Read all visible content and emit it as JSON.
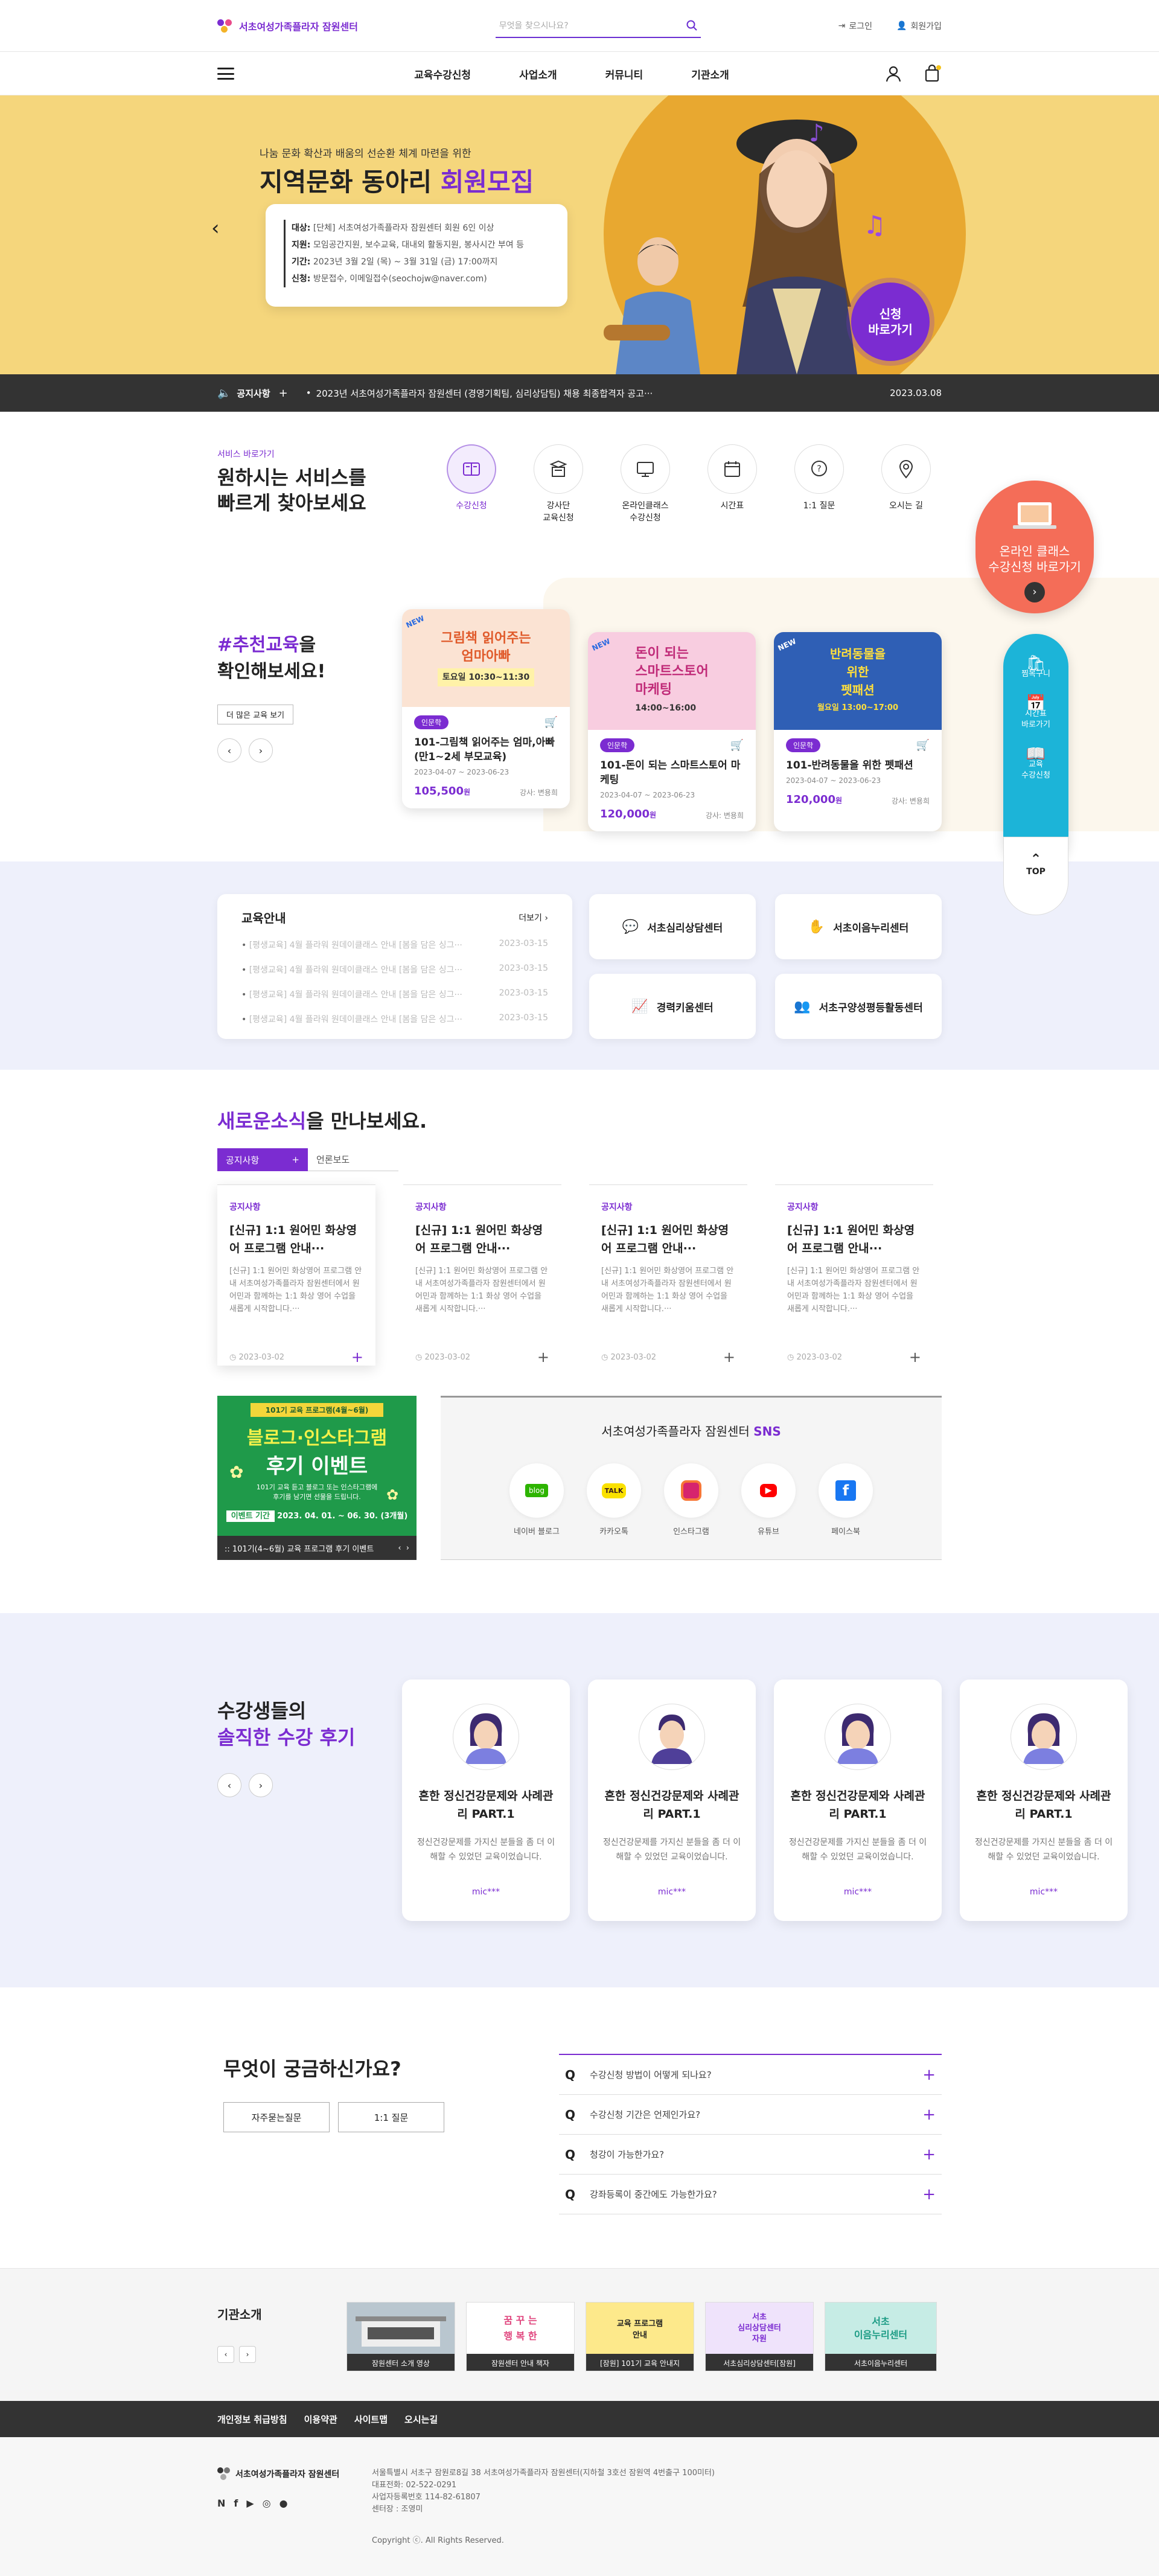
{
  "header": {
    "site_name": "서초여성가족플라자 잠원센터",
    "search_placeholder": "무엇을 찾으시나요?",
    "login": "로그인",
    "signup": "회원가입"
  },
  "gnb": {
    "items": [
      "교육수강신청",
      "사업소개",
      "커뮤니티",
      "기관소개"
    ]
  },
  "hero": {
    "subtitle": "나눔 문화 확산과 배움의 선순환 체계 마련을 위한",
    "title_prefix": "지역문화 동아리 ",
    "title_highlight": "회원모집",
    "rows": [
      {
        "label": "대상:",
        "text": "[단체] 서초여성가족플라자 잠원센터 회원 6인 이상"
      },
      {
        "label": "지원:",
        "text": "모임공간지원, 보수교육, 대내외 활동지원, 봉사시간 부여 등"
      },
      {
        "label": "기간:",
        "text": "2023년 3월 2일 (목) ~ 3월 31일 (금) 17:00까지"
      },
      {
        "label": "신청:",
        "text": "방문접수, 이메일접수(seochojw@naver.com)"
      }
    ],
    "cta": "신청\n바로가기"
  },
  "notice_bar": {
    "label": "공지사항",
    "text": "2023년 서초여성가족플라자 잠원센터 (경영기획팀, 심리상담팀) 채용 최종합격자 공고···",
    "date": "2023.03.08"
  },
  "quick": {
    "label": "서비스 바로가기",
    "title_line1": "원하시는 서비스를",
    "title_line2": "빠르게 찾아보세요",
    "items": [
      "수강신청",
      "강사단\n교육신청",
      "온라인클래스\n수강신청",
      "시간표",
      "1:1 질문",
      "오시는 길"
    ]
  },
  "recommend": {
    "title_highlight": "#추천교육",
    "title_rest1": "을",
    "title_line2": "확인해보세요!",
    "more": "더 많은 교육 보기",
    "cards": [
      {
        "thumb": "그림책 읽어주는\n엄마아빠",
        "thumb_sub": "토요일 10:30~11:30",
        "badge": "인문학",
        "title": "101-그림책 읽어주는 엄마,아빠(만1~2세 부모교육)",
        "date": "2023-04-07 ~ 2023-06-23",
        "price": "105,500",
        "won": "원",
        "teacher": "강사: 변용희"
      },
      {
        "thumb": "돈이 되는\n스마트스토어\n마케팅",
        "thumb_sub": "14:00~16:00",
        "badge": "인문학",
        "title": "101-돈이 되는 스마트스토어 마케팅",
        "date": "2023-04-07 ~ 2023-06-23",
        "price": "120,000",
        "won": "원",
        "teacher": "강사: 변용희"
      },
      {
        "thumb": "반려동물을\n위한\n펫패션",
        "thumb_sub": "월요일 13:00~17:00",
        "badge": "인문학",
        "title": "101-반려동물을 위한 펫패션",
        "date": "2023-04-07 ~ 2023-06-23",
        "price": "120,000",
        "won": "원",
        "teacher": "강사: 변용희"
      }
    ]
  },
  "edu_info": {
    "title": "교육안내",
    "more": "더보기",
    "items": [
      {
        "text": "[평생교육] 4월 플라워 원데이클래스 안내 [봄을 담은 싱그···",
        "date": "2023-03-15"
      },
      {
        "text": "[평생교육] 4월 플라워 원데이클래스 안내 [봄을 담은 싱그···",
        "date": "2023-03-15"
      },
      {
        "text": "[평생교육] 4월 플라워 원데이클래스 안내 [봄을 담은 싱그···",
        "date": "2023-03-15"
      },
      {
        "text": "[평생교육] 4월 플라워 원데이클래스 안내 [봄을 담은 싱그···",
        "date": "2023-03-15"
      }
    ],
    "centers": [
      "서초심리상담센터",
      "서초이음누리센터",
      "경력키움센터",
      "서초구양성평등활동센터"
    ]
  },
  "news": {
    "title_highlight": "새로운소식",
    "title_rest": "을 만나보세요.",
    "tab_active": "공지사항",
    "tab_other": "언론보도",
    "cards": [
      {
        "label": "공지사항",
        "title": "[신규] 1:1 원어민 화상영어 프로그램 안내···",
        "text": "[신규] 1:1 원어민 화상영어 프로그램 안내 서초여성가족플라자 잠원센터에서 원어민과 함께하는 1:1 화상 영어 수업을 새롭게 시작합니다.···",
        "date": "2023-03-02"
      },
      {
        "label": "공지사항",
        "title": "[신규] 1:1 원어민 화상영어 프로그램 안내···",
        "text": "[신규] 1:1 원어민 화상영어 프로그램 안내 서초여성가족플라자 잠원센터에서 원어민과 함께하는 1:1 화상 영어 수업을 새롭게 시작합니다.···",
        "date": "2023-03-02"
      },
      {
        "label": "공지사항",
        "title": "[신규] 1:1 원어민 화상영어 프로그램 안내···",
        "text": "[신규] 1:1 원어민 화상영어 프로그램 안내 서초여성가족플라자 잠원센터에서 원어민과 함께하는 1:1 화상 영어 수업을 새롭게 시작합니다.···",
        "date": "2023-03-02"
      },
      {
        "label": "공지사항",
        "title": "[신규] 1:1 원어민 화상영어 프로그램 안내···",
        "text": "[신규] 1:1 원어민 화상영어 프로그램 안내 서초여성가족플라자 잠원센터에서 원어민과 함께하는 1:1 화상 영어 수업을 새롭게 시작합니다.···",
        "date": "2023-03-02"
      }
    ]
  },
  "event_banner": {
    "top": "101기 교육 프로그램(4월~6월)",
    "title1": "블로그·인스타그램",
    "title2": "후기 이벤트",
    "desc": "101기 교육 듣고 블로그 또는 인스타그램에 후기를 남기면 선물을 드립니다.",
    "period_label": "이벤트 기간",
    "period": "2023. 04. 01. ~ 06. 30. (3개월)",
    "caption": ":: 101기(4~6월) 교육 프로그램 후기 이벤트"
  },
  "sns": {
    "title_prefix": "서초여성가족플라자 잠원센터 ",
    "title_highlight": "SNS",
    "items": [
      "네이버 블로그",
      "카카오톡",
      "인스타그램",
      "유튜브",
      "페이스북"
    ]
  },
  "reviews": {
    "title_line1": "수강생들의",
    "title_line2": "솔직한 수강 후기",
    "cards": [
      {
        "title": "흔한 정신건강문제와 사례관리 PART.1",
        "text": "정신건강문제를 가지신 분들을 좀 더 이해할 수 있었던 교육이었습니다.",
        "name": "mic***"
      },
      {
        "title": "흔한 정신건강문제와 사례관리 PART.1",
        "text": "정신건강문제를 가지신 분들을 좀 더 이해할 수 있었던 교육이었습니다.",
        "name": "mic***"
      },
      {
        "title": "흔한 정신건강문제와 사례관리 PART.1",
        "text": "정신건강문제를 가지신 분들을 좀 더 이해할 수 있었던 교육이었습니다.",
        "name": "mic***"
      },
      {
        "title": "흔한 정신건강문제와 사례관리 PART.1",
        "text": "정신건강문제를 가지신 분들을 좀 더 이해할 수 있었던 교육이었습니다.",
        "name": "mic***"
      }
    ]
  },
  "faq": {
    "title": "무엇이 궁금하신가요?",
    "btn_faq": "자주묻는질문",
    "btn_qna": "1:1 질문",
    "items": [
      "수강신청 방법이 어떻게 되나요?",
      "수강신청 기간은 언제인가요?",
      "청강이 가능한가요?",
      "강좌등록이 중간에도 가능한가요?"
    ]
  },
  "org": {
    "title": "기관소개",
    "cards": [
      {
        "img": "",
        "cap": "잠원센터 소개 영상"
      },
      {
        "img": "꿈 꾸 는\n행 복 한",
        "cap": "잠원센터 안내 책자"
      },
      {
        "img": "교육 프로그램\n안내",
        "cap": "[잠원] 101기 교육 안내지"
      },
      {
        "img": "서초\n심리상담센터\n자원",
        "cap": "서초심리상담센터[잠원]"
      },
      {
        "img": "서초\n이음누리센터",
        "cap": "서초이음누리센터"
      }
    ]
  },
  "footer_links": [
    "개인정보 취급방침",
    "이용약관",
    "사이트맵",
    "오시는길"
  ],
  "footer": {
    "name": "서초여성가족플라자 잠원센터",
    "address": "서울특별시 서초구 잠원로8길 38 서초여성가족플라자 잠원센터(지하철 3호선 잠원역 4번출구 100미터)",
    "phone": "대표전화: 02-522-0291",
    "bizno": "사업자등록번호 114-82-61807",
    "ceo": "센터장 : 조영미",
    "copyright": "Copyright ⓒ. All Rights Reserved."
  },
  "floating": {
    "online": "온라인 클래스\n수강신청 바로가기",
    "items": [
      "찜목구니",
      "시간표\n바로가기",
      "교육\n수강신청"
    ],
    "top": "TOP"
  },
  "colors": {
    "brand": "#7b2cd1",
    "hero_bg": "#f5d67c",
    "float_coral": "#f46d58",
    "float_cyan": "#1cb4d8"
  }
}
